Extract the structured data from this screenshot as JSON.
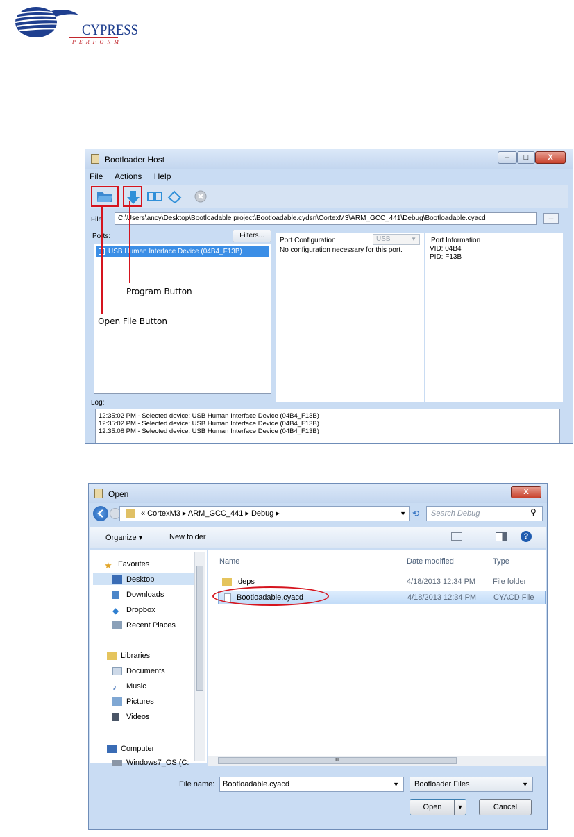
{
  "logo": {
    "wordmark": "CYPRESS",
    "tagline": "PERFORM"
  },
  "bootloader_window": {
    "title": "Bootloader Host",
    "minimize_glyph": "–",
    "maximize_glyph": "□",
    "close_glyph": "X",
    "menu": [
      "File",
      "Actions",
      "Help"
    ],
    "file_label": "File:",
    "file_path": "C:\\Users\\ancy\\Desktop\\Bootloadable project\\Bootloadable.cydsn\\CortexM3\\ARM_GCC_441\\Debug\\Bootloadable.cyacd",
    "browse_label": "...",
    "ports_label": "Ports:",
    "filters_label": "Filters...",
    "ports": [
      "USB Human Interface Device (04B4_F13B)"
    ],
    "port_configuration": {
      "title": "Port Configuration",
      "combo_value": "USB",
      "text": "No configuration necessary for this port."
    },
    "port_information": {
      "title": "Port Information",
      "vid": "VID: 04B4",
      "pid": "PID: F13B"
    },
    "log_label": "Log:",
    "log_lines": [
      "12:35:02 PM - Selected device: USB Human Interface Device (04B4_F13B)",
      "12:35:02 PM - Selected device: USB Human Interface Device (04B4_F13B)",
      "12:35:08 PM - Selected device: USB Human Interface Device (04B4_F13B)"
    ]
  },
  "callouts": {
    "program_button": "Program Button",
    "open_file_button": "Open File Button"
  },
  "open_dialog": {
    "title": "Open",
    "close_glyph": "X",
    "breadcrumb": "« CortexM3 ▸ ARM_GCC_441 ▸ Debug ▸",
    "search_placeholder": "Search Debug",
    "organize_label": "Organize ▾",
    "new_folder_label": "New folder",
    "nav": {
      "favorites": "Favorites",
      "desktop": "Desktop",
      "downloads": "Downloads",
      "dropbox": "Dropbox",
      "recent_places": "Recent Places",
      "libraries": "Libraries",
      "documents": "Documents",
      "music": "Music",
      "pictures": "Pictures",
      "videos": "Videos",
      "computer": "Computer",
      "windows7_os": "Windows7_OS (C:"
    },
    "columns": {
      "name": "Name",
      "date_modified": "Date modified",
      "type": "Type"
    },
    "files": [
      {
        "name": ".deps",
        "date": "4/18/2013 12:34 PM",
        "type": "File folder"
      },
      {
        "name": "Bootloadable.cyacd",
        "date": "4/18/2013 12:34 PM",
        "type": "CYACD File"
      }
    ],
    "file_name_label": "File name:",
    "file_name_value": "Bootloadable.cyacd",
    "file_type_value": "Bootloader Files",
    "open_label": "Open",
    "cancel_label": "Cancel",
    "scroll_grip": "III"
  }
}
